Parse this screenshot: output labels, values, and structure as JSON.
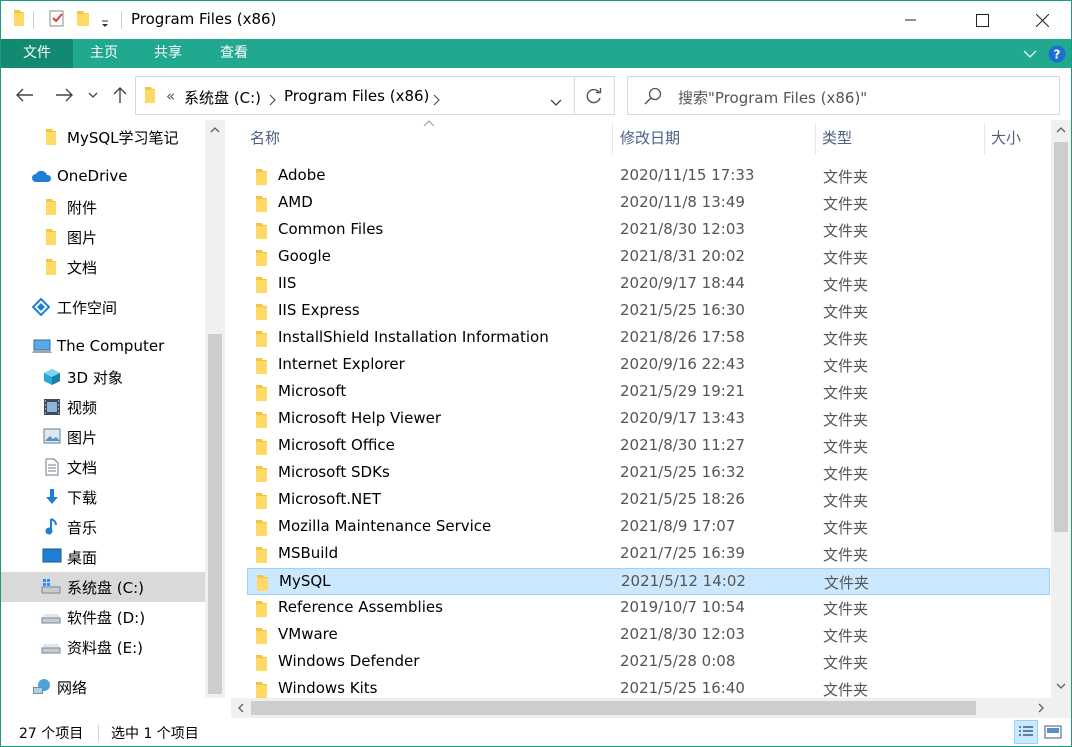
{
  "window": {
    "title": "Program Files (x86)",
    "accent": "#20a98f"
  },
  "ribbon": {
    "tabs": [
      {
        "label": "文件"
      },
      {
        "label": "主页"
      },
      {
        "label": "共享"
      },
      {
        "label": "查看"
      }
    ]
  },
  "address": {
    "overflow": "«",
    "segments": [
      "系统盘 (C:)",
      "Program Files (x86)"
    ]
  },
  "search": {
    "placeholder": "搜索\"Program Files (x86)\""
  },
  "nav": {
    "items": [
      {
        "label": "MySQL学习笔记",
        "icon": "folder-icon"
      },
      {
        "label": "OneDrive",
        "icon": "cloud-icon"
      },
      {
        "label": "附件",
        "icon": "folder-icon"
      },
      {
        "label": "图片",
        "icon": "folder-icon"
      },
      {
        "label": "文档",
        "icon": "folder-icon"
      },
      {
        "label": "工作空间",
        "icon": "workspace-icon"
      },
      {
        "label": "The Computer",
        "icon": "computer-icon"
      },
      {
        "label": "3D 对象",
        "icon": "cube-icon"
      },
      {
        "label": "视频",
        "icon": "video-icon"
      },
      {
        "label": "图片",
        "icon": "picture-icon"
      },
      {
        "label": "文档",
        "icon": "document-icon"
      },
      {
        "label": "下载",
        "icon": "download-icon"
      },
      {
        "label": "音乐",
        "icon": "music-icon"
      },
      {
        "label": "桌面",
        "icon": "desktop-icon"
      },
      {
        "label": "系统盘 (C:)",
        "icon": "system-drive-icon"
      },
      {
        "label": "软件盘 (D:)",
        "icon": "drive-icon"
      },
      {
        "label": "资料盘 (E:)",
        "icon": "drive-icon"
      },
      {
        "label": "网络",
        "icon": "network-icon"
      }
    ]
  },
  "columns": {
    "name": "名称",
    "date": "修改日期",
    "type": "类型",
    "size": "大小"
  },
  "files": [
    {
      "name": "Adobe",
      "date": "2020/11/15 17:33",
      "type": "文件夹"
    },
    {
      "name": "AMD",
      "date": "2020/11/8 13:49",
      "type": "文件夹"
    },
    {
      "name": "Common Files",
      "date": "2021/8/30 12:03",
      "type": "文件夹"
    },
    {
      "name": "Google",
      "date": "2021/8/31 20:02",
      "type": "文件夹"
    },
    {
      "name": "IIS",
      "date": "2020/9/17 18:44",
      "type": "文件夹"
    },
    {
      "name": "IIS Express",
      "date": "2021/5/25 16:30",
      "type": "文件夹"
    },
    {
      "name": "InstallShield Installation Information",
      "date": "2021/8/26 17:58",
      "type": "文件夹"
    },
    {
      "name": "Internet Explorer",
      "date": "2020/9/16 22:43",
      "type": "文件夹"
    },
    {
      "name": "Microsoft",
      "date": "2021/5/29 19:21",
      "type": "文件夹"
    },
    {
      "name": "Microsoft Help Viewer",
      "date": "2020/9/17 13:43",
      "type": "文件夹"
    },
    {
      "name": "Microsoft Office",
      "date": "2021/8/30 11:27",
      "type": "文件夹"
    },
    {
      "name": "Microsoft SDKs",
      "date": "2021/5/25 16:32",
      "type": "文件夹"
    },
    {
      "name": "Microsoft.NET",
      "date": "2021/5/25 18:26",
      "type": "文件夹"
    },
    {
      "name": "Mozilla Maintenance Service",
      "date": "2021/8/9 17:07",
      "type": "文件夹"
    },
    {
      "name": "MSBuild",
      "date": "2021/7/25 16:39",
      "type": "文件夹"
    },
    {
      "name": "MySQL",
      "date": "2021/5/12 14:02",
      "type": "文件夹"
    },
    {
      "name": "Reference Assemblies",
      "date": "2019/10/7 10:54",
      "type": "文件夹"
    },
    {
      "name": "VMware",
      "date": "2021/8/30 12:03",
      "type": "文件夹"
    },
    {
      "name": "Windows Defender",
      "date": "2021/5/28 0:08",
      "type": "文件夹"
    },
    {
      "name": "Windows Kits",
      "date": "2021/5/25 16:40",
      "type": "文件夹"
    }
  ],
  "status": {
    "count": "27 个项目",
    "selected": "选中 1 个项目"
  }
}
